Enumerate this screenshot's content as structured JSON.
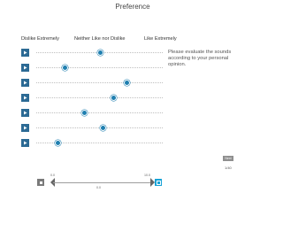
{
  "title": "Preference",
  "scale": {
    "left_label": "Dislike Extremely",
    "middle_label": "Neither Like nor Dislike",
    "right_label": "Like Extremely"
  },
  "instructions": "Please evaluate the sounds according to your personal opinion.",
  "ratings": [
    {
      "value": 0.51
    },
    {
      "value": 0.23
    },
    {
      "value": 0.72
    },
    {
      "value": 0.61
    },
    {
      "value": 0.38
    },
    {
      "value": 0.53
    },
    {
      "value": 0.17
    }
  ],
  "navigation": {
    "next_label": "Next",
    "counter": "1/40"
  },
  "transport": {
    "start_time": "0.0",
    "end_time": "10.0",
    "current_time": "0.0"
  },
  "colors": {
    "accent": "#1f7fb0",
    "play_button": "#2c6a94",
    "loop_button": "#18a3d7"
  }
}
